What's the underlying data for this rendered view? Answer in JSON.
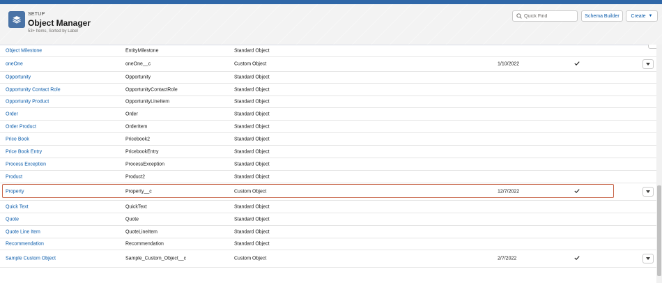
{
  "header": {
    "setup_label": "SETUP",
    "title": "Object Manager",
    "subtitle": "53+ Items, Sorted by Label",
    "quick_find_placeholder": "Quick Find",
    "schema_builder_label": "Schema Builder",
    "create_label": "Create"
  },
  "rows": [
    {
      "label": "Object Milestone",
      "api": "EntityMilestone",
      "type": "Standard Object",
      "modified": "",
      "deployed": false,
      "menu": false
    },
    {
      "label": "oneOne",
      "api": "oneOne__c",
      "type": "Custom Object",
      "modified": "1/10/2022",
      "deployed": true,
      "menu": true
    },
    {
      "label": "Opportunity",
      "api": "Opportunity",
      "type": "Standard Object",
      "modified": "",
      "deployed": false,
      "menu": false
    },
    {
      "label": "Opportunity Contact Role",
      "api": "OpportunityContactRole",
      "type": "Standard Object",
      "modified": "",
      "deployed": false,
      "menu": false
    },
    {
      "label": "Opportunity Product",
      "api": "OpportunityLineItem",
      "type": "Standard Object",
      "modified": "",
      "deployed": false,
      "menu": false
    },
    {
      "label": "Order",
      "api": "Order",
      "type": "Standard Object",
      "modified": "",
      "deployed": false,
      "menu": false
    },
    {
      "label": "Order Product",
      "api": "OrderItem",
      "type": "Standard Object",
      "modified": "",
      "deployed": false,
      "menu": false
    },
    {
      "label": "Price Book",
      "api": "Pricebook2",
      "type": "Standard Object",
      "modified": "",
      "deployed": false,
      "menu": false
    },
    {
      "label": "Price Book Entry",
      "api": "PricebookEntry",
      "type": "Standard Object",
      "modified": "",
      "deployed": false,
      "menu": false
    },
    {
      "label": "Process Exception",
      "api": "ProcessException",
      "type": "Standard Object",
      "modified": "",
      "deployed": false,
      "menu": false
    },
    {
      "label": "Product",
      "api": "Product2",
      "type": "Standard Object",
      "modified": "",
      "deployed": false,
      "menu": false
    },
    {
      "label": "Property",
      "api": "Property__c",
      "type": "Custom Object",
      "modified": "12/7/2022",
      "deployed": true,
      "menu": true,
      "highlighted": true
    },
    {
      "label": "Quick Text",
      "api": "QuickText",
      "type": "Standard Object",
      "modified": "",
      "deployed": false,
      "menu": false
    },
    {
      "label": "Quote",
      "api": "Quote",
      "type": "Standard Object",
      "modified": "",
      "deployed": false,
      "menu": false
    },
    {
      "label": "Quote Line Item",
      "api": "QuoteLineItem",
      "type": "Standard Object",
      "modified": "",
      "deployed": false,
      "menu": false
    },
    {
      "label": "Recommendation",
      "api": "Recommendation",
      "type": "Standard Object",
      "modified": "",
      "deployed": false,
      "menu": false
    },
    {
      "label": "Sample Custom Object",
      "api": "Sample_Custom_Object__c",
      "type": "Custom Object",
      "modified": "2/7/2022",
      "deployed": true,
      "menu": true
    }
  ]
}
